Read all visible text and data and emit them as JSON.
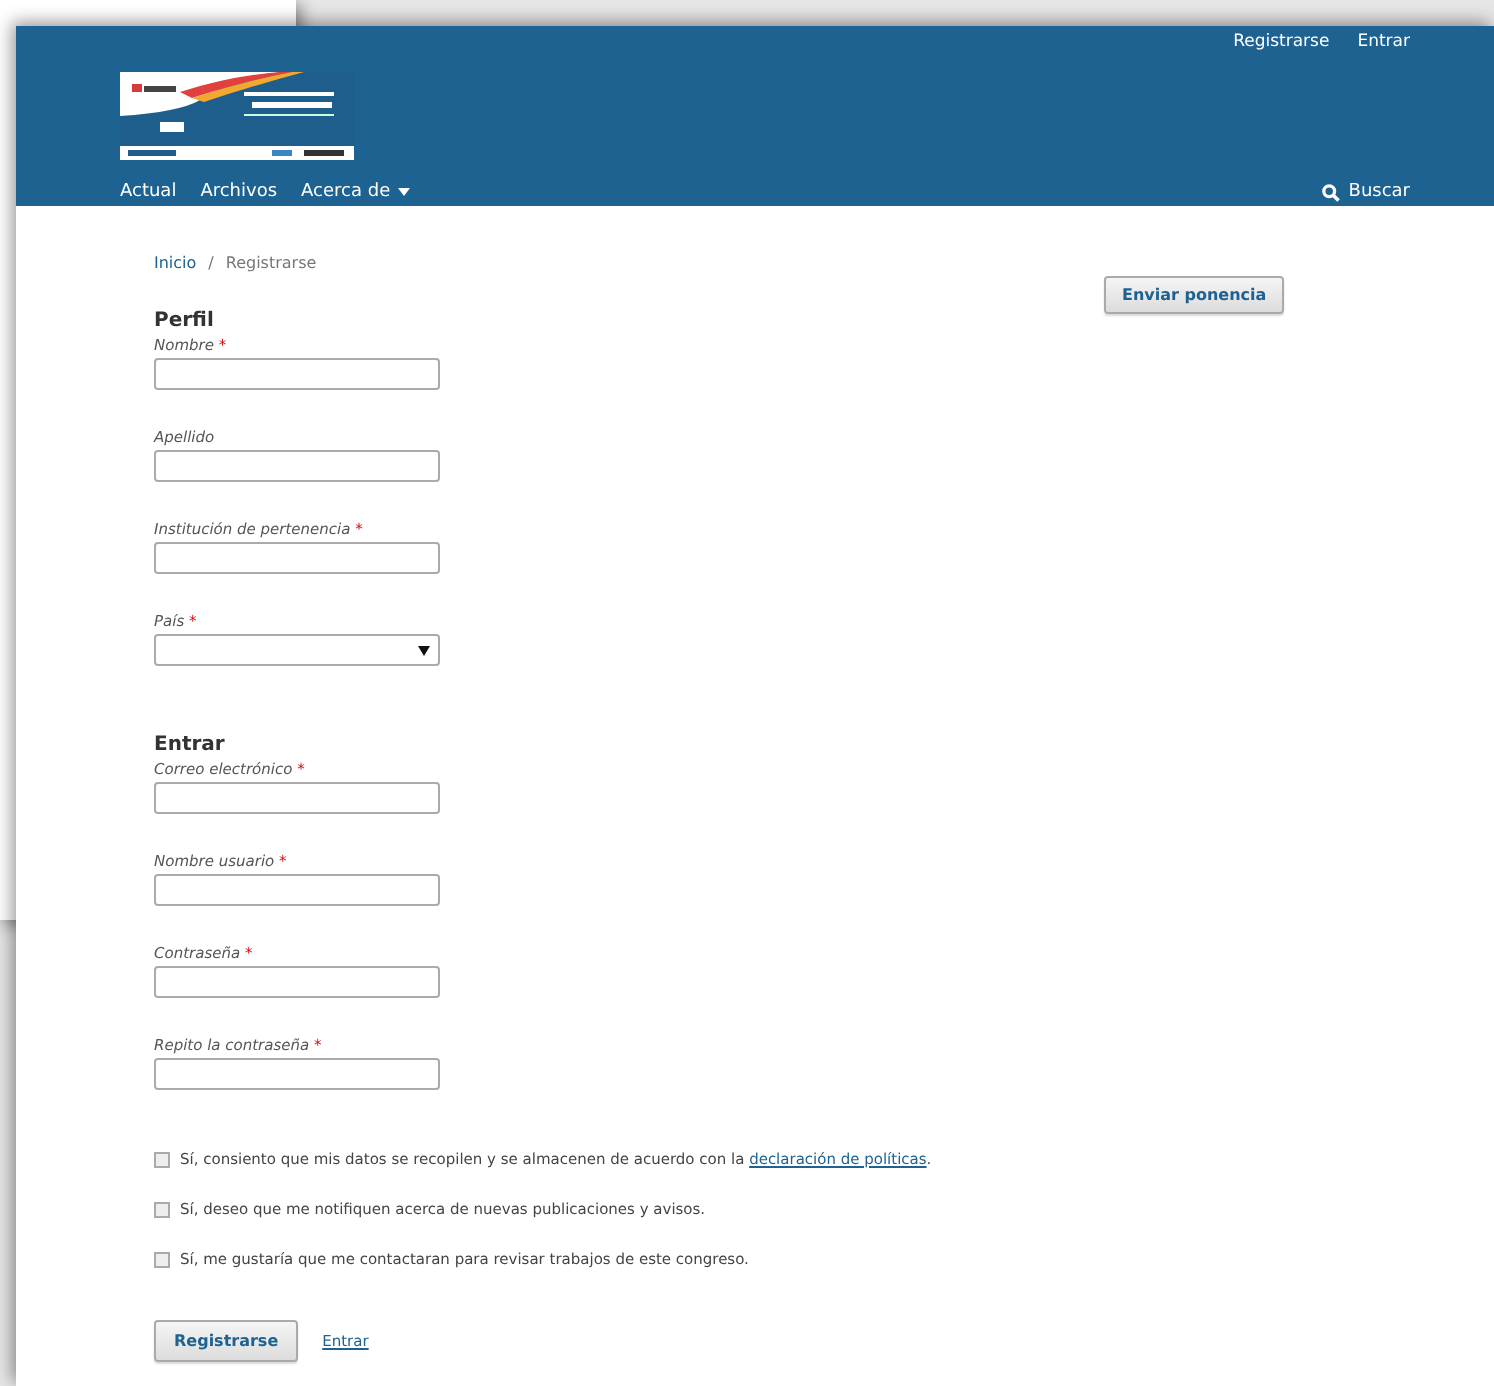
{
  "header": {
    "user_links": [
      "Registrarse",
      "Entrar"
    ],
    "logo": {
      "kind": "picture"
    },
    "nav": [
      {
        "label": "Actual",
        "dropdown": false
      },
      {
        "label": "Archivos",
        "dropdown": false
      },
      {
        "label": "Acerca de",
        "dropdown": true
      }
    ],
    "search_label": "Buscar"
  },
  "breadcrumb_separator": "/",
  "breadcrumb": [
    {
      "label": "Inicio",
      "link": true
    },
    {
      "label": "Registrarse",
      "link": false
    }
  ],
  "sidebar_button": "Enviar ponencia",
  "sections": [
    {
      "title": "Perfil",
      "fields": [
        {
          "label": "Nombre",
          "required": true,
          "kind": "text"
        },
        {
          "label": "Apellido",
          "required": false,
          "kind": "text"
        },
        {
          "label": "Institución de pertenencia",
          "required": true,
          "kind": "text"
        },
        {
          "label": "País",
          "required": true,
          "kind": "select"
        }
      ]
    },
    {
      "title": "Entrar",
      "fields": [
        {
          "label": "Correo electrónico",
          "required": true,
          "kind": "text"
        },
        {
          "label": "Nombre usuario",
          "required": true,
          "kind": "text"
        },
        {
          "label": "Contraseña",
          "required": true,
          "kind": "text"
        },
        {
          "label": "Repito la contraseña",
          "required": true,
          "kind": "text"
        }
      ]
    }
  ],
  "required_mark": "*",
  "consents": [
    {
      "text": "Sí, consiento que mis datos se recopilen y se almacenen de acuerdo con la ",
      "link": "declaración de políticas",
      "after": ".",
      "checked": false
    },
    {
      "text": "Sí, deseo que me notifiquen acerca de nuevas publicaciones y avisos.",
      "checked": false
    },
    {
      "text": "Sí, me gustaría que me contactaran para revisar trabajos de este congreso.",
      "checked": false
    }
  ],
  "submit_button": "Registrarse",
  "login_link": "Entrar"
}
